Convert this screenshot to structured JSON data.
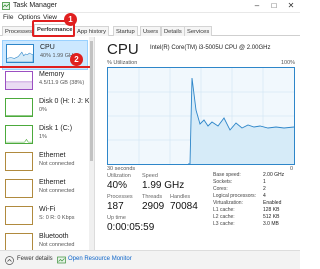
{
  "window": {
    "title": "Task Manager",
    "minimize": "–",
    "maximize": "□",
    "close": "✕"
  },
  "menu": [
    "File",
    "Options",
    "View"
  ],
  "tabs": [
    "Processes",
    "Performance",
    "App history",
    "Startup",
    "Users",
    "Details",
    "Services"
  ],
  "callouts": {
    "one": "1",
    "two": "2"
  },
  "sidebar": {
    "items": [
      {
        "label": "CPU",
        "sub": "40%  1.99 GHz"
      },
      {
        "label": "Memory",
        "sub": "4.5/11.9 GB (38%)"
      },
      {
        "label": "Disk 0 (H: I: J: K:)",
        "sub": "0%"
      },
      {
        "label": "Disk 1 (C:)",
        "sub": "1%"
      },
      {
        "label": "Ethernet",
        "sub": "Not connected"
      },
      {
        "label": "Ethernet",
        "sub": "Not connected"
      },
      {
        "label": "Wi-Fi",
        "sub": "S: 0 R: 0 Kbps"
      },
      {
        "label": "Bluetooth",
        "sub": "Not connected"
      }
    ]
  },
  "main": {
    "title": "CPU",
    "model": "Intel(R) Core(TM) i3-5005U CPU @ 2.00GHz",
    "graph_label_left": "% Utilization",
    "graph_label_right": "100%",
    "graph_time_left": "30 seconds",
    "graph_time_right": "0",
    "utilization_label": "Utilization",
    "utilization_value": "40%",
    "speed_label": "Speed",
    "speed_value": "1.99 GHz",
    "processes_label": "Processes",
    "processes_value": "187",
    "threads_label": "Threads",
    "threads_value": "2909",
    "handles_label": "Handles",
    "handles_value": "70084",
    "uptime_label": "Up time",
    "uptime_value": "0:00:05:59",
    "info": [
      {
        "label": "Base speed:",
        "value": "2.00 GHz"
      },
      {
        "label": "Sockets:",
        "value": "1"
      },
      {
        "label": "Cores:",
        "value": "2"
      },
      {
        "label": "Logical processors:",
        "value": "4"
      },
      {
        "label": "Virtualization:",
        "value": "Enabled"
      },
      {
        "label": "L1 cache:",
        "value": "128 KB"
      },
      {
        "label": "L2 cache:",
        "value": "512 KB"
      },
      {
        "label": "L3 cache:",
        "value": "3.0 MB"
      }
    ]
  },
  "footer": {
    "fewer_details": "Fewer details",
    "open_monitor": "Open Resource Monitor"
  },
  "colors": {
    "accent": "#2e86c9",
    "graph_fill": "#d6ebf8",
    "callout": "#e01f1f",
    "link": "#0a63c9"
  }
}
